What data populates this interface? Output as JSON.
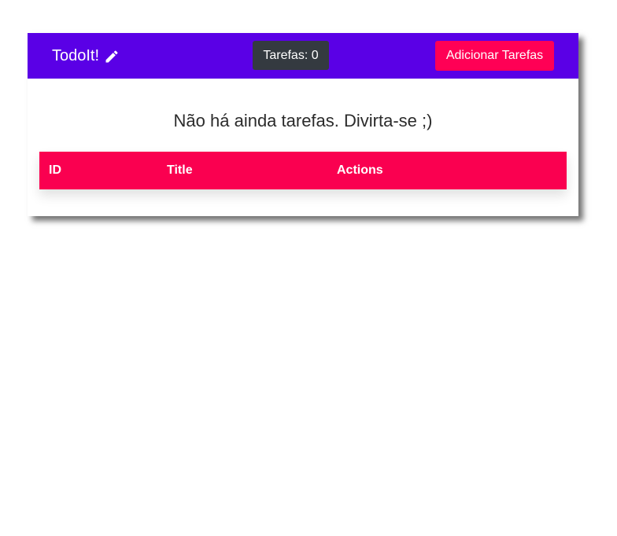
{
  "navbar": {
    "brand": "TodoIt!",
    "brand_icon": "pencil-icon",
    "counter_label": "Tarefas: 0",
    "add_button_label": "Adicionar Tarefas",
    "colors": {
      "navbar_bg": "#5a00e6",
      "counter_bg": "#343a40",
      "accent": "#ff0055"
    }
  },
  "main": {
    "empty_message": "Não há ainda tarefas. Divirta-se ;)"
  },
  "table": {
    "columns": [
      "ID",
      "Title",
      "Actions"
    ],
    "rows": []
  }
}
